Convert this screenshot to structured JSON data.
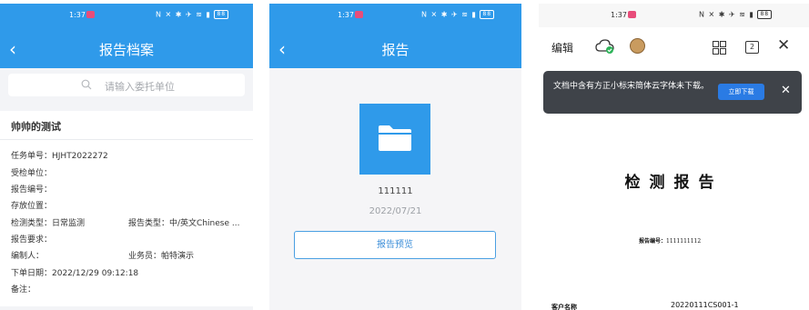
{
  "status_bar": {
    "time": "1:37",
    "battery": "88"
  },
  "panel1": {
    "header": {
      "title": "报告档案"
    },
    "search": {
      "placeholder": "请输入委托单位"
    },
    "card": {
      "title": "帅帅的测试",
      "fields": {
        "task_no": "任务单号：HJHT2022272",
        "inspected_unit": "受检单位：",
        "report_no": "报告编号：",
        "storage": "存放位置：",
        "inspection_type": "检测类型：日常监测",
        "report_type": "报告类型：中/英文Chinese ...",
        "report_req": "报告要求：",
        "editor": "编制人：",
        "salesperson": "业务员：帕特演示",
        "issue_date": "下单日期：2022/12/29 09:12:18",
        "remark": "备注："
      }
    }
  },
  "panel2": {
    "header": {
      "title": "报告"
    },
    "file": {
      "name": "111111",
      "date": "2022/07/21"
    },
    "preview_button": "报告预览"
  },
  "panel3": {
    "toolbar": {
      "edit_label": "编辑",
      "page_count": "2"
    },
    "toast": {
      "message": "文档中含有方正小标宋简体云字体未下载。",
      "download_button": "立即下载"
    },
    "document": {
      "title": "检测报告",
      "report_no_label": "报告编号：",
      "report_no_value": "1111111112",
      "client_label": "客户名称",
      "client_value": "20220111CS001-1"
    }
  },
  "colors": {
    "brand_blue": "#2f9aea",
    "toast_bg": "#3f4349",
    "download_blue": "#2a7be4"
  }
}
